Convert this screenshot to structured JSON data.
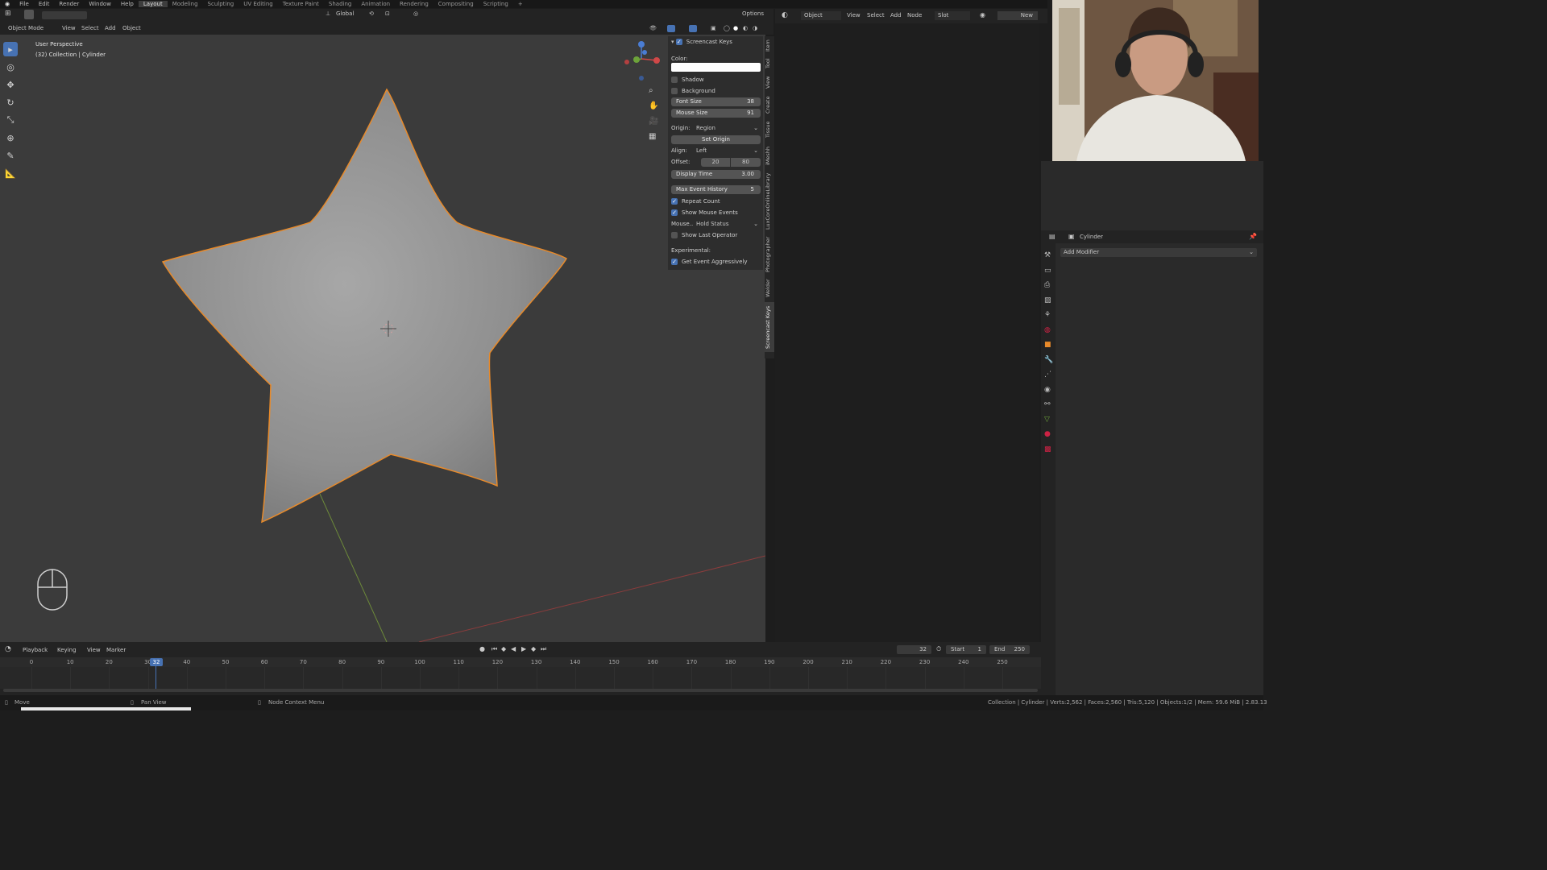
{
  "topbar": {
    "menus": [
      "File",
      "Edit",
      "Render",
      "Window",
      "Help"
    ],
    "workspaces": [
      "Layout",
      "Modeling",
      "Sculpting",
      "UV Editing",
      "Texture Paint",
      "Shading",
      "Animation",
      "Rendering",
      "Compositing",
      "Scripting"
    ],
    "active_workspace": "Layout",
    "add_workspace": "+"
  },
  "viewport_header": {
    "orientation": "Global",
    "options": "Options",
    "mode": "Object Mode",
    "menus": [
      "View",
      "Select",
      "Add",
      "Object"
    ]
  },
  "viewport": {
    "view_name": "User Perspective",
    "collection_info": "(32) Collection | Cylinder"
  },
  "screencast_keys": {
    "title": "Screencast Keys",
    "color_label": "Color:",
    "shadow": "Shadow",
    "background": "Background",
    "font_size_label": "Font Size",
    "font_size": "38",
    "mouse_size_label": "Mouse Size",
    "mouse_size": "91",
    "origin_label": "Origin:",
    "origin_value": "Region",
    "set_origin": "Set Origin",
    "align_label": "Align:",
    "align_value": "Left",
    "offset_label": "Offset:",
    "offset_x": "20",
    "offset_y": "80",
    "display_time_label": "Display Time",
    "display_time": "3.00",
    "max_event_label": "Max Event History",
    "max_event": "5",
    "repeat_count": "Repeat Count",
    "show_mouse_events": "Show Mouse Events",
    "mouse_label": "Mouse...",
    "mouse_value": "Hold Status",
    "show_last_operator": "Show Last Operator",
    "experimental": "Experimental:",
    "get_event_aggressively": "Get Event Aggressively"
  },
  "sidebar_tabs": [
    "Item",
    "Tool",
    "View",
    "Create",
    "Tissue",
    "iMeshh",
    "LuxCoreOnlineLibrary",
    "Photographer",
    "Welder",
    "Screencast Keys"
  ],
  "node_editor_header": {
    "mode": "Object",
    "menus": [
      "View",
      "Select",
      "Add",
      "Node"
    ],
    "slot": "Slot",
    "new_button": "New"
  },
  "properties": {
    "object_name": "Cylinder",
    "add_modifier": "Add Modifier"
  },
  "timeline": {
    "menus": [
      "Playback",
      "Keying",
      "View",
      "Marker"
    ],
    "current_frame": "32",
    "start_label": "Start",
    "start": "1",
    "end_label": "End",
    "end": "250",
    "ticks": [
      "0",
      "10",
      "20",
      "30",
      "40",
      "50",
      "60",
      "70",
      "80",
      "90",
      "100",
      "110",
      "120",
      "130",
      "140",
      "150",
      "160",
      "170",
      "180",
      "190",
      "200",
      "210",
      "220",
      "230",
      "240",
      "250"
    ]
  },
  "statusbar": {
    "move": "Move",
    "pan_view": "Pan View",
    "node_context": "Node Context Menu",
    "stats": "Collection | Cylinder | Verts:2,562 | Faces:2,560 | Tris:5,120 | Objects:1/2 | Mem: 59.6 MiB | 2.83.13"
  },
  "colors": {
    "accent_blue": "#4772b3",
    "selection_outline": "#e88a2a",
    "viewport_bg": "#3b3b3b"
  }
}
